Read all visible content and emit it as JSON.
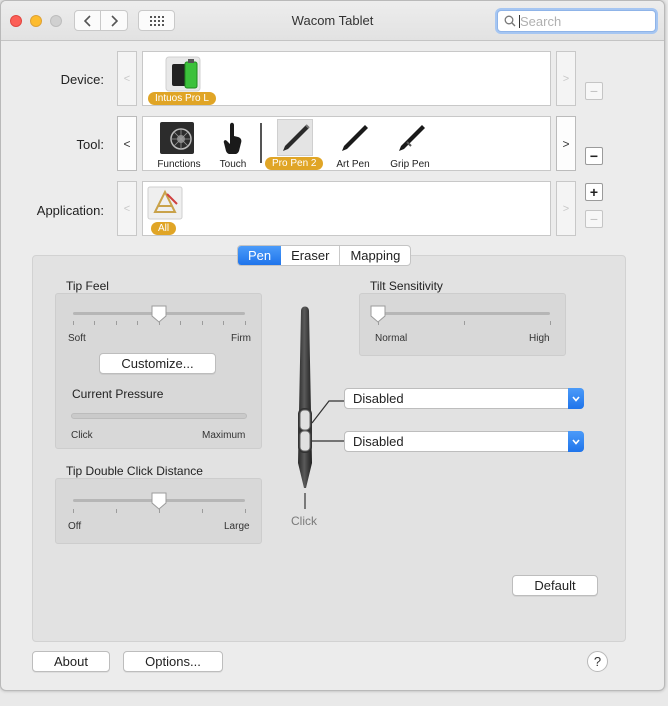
{
  "window": {
    "title": "Wacom Tablet",
    "search": {
      "placeholder": "Search"
    }
  },
  "device": {
    "label": "Device:",
    "items": [
      {
        "name": "Intuos Pro L",
        "selected": true
      }
    ]
  },
  "tool": {
    "label": "Tool:",
    "items": [
      {
        "name": "Functions"
      },
      {
        "name": "Touch"
      },
      {
        "name": "Pro Pen 2",
        "selected": true
      },
      {
        "name": "Art Pen"
      },
      {
        "name": "Grip Pen"
      }
    ]
  },
  "application": {
    "label": "Application:",
    "items": [
      {
        "name": "All",
        "selected": true
      }
    ]
  },
  "tabs": [
    "Pen",
    "Eraser",
    "Mapping"
  ],
  "tip_feel": {
    "title": "Tip Feel",
    "min_label": "Soft",
    "max_label": "Firm",
    "value": 0.5,
    "customize_label": "Customize...",
    "pressure_title": "Current Pressure",
    "pressure_min": "Click",
    "pressure_max": "Maximum",
    "pressure_value": 0
  },
  "tilt": {
    "title": "Tilt Sensitivity",
    "min_label": "Normal",
    "max_label": "High",
    "value": 0
  },
  "double_click": {
    "title": "Tip Double Click Distance",
    "min_label": "Off",
    "max_label": "Large",
    "value": 0.5
  },
  "pen_buttons": {
    "upper": "Disabled",
    "lower": "Disabled",
    "tip": "Click"
  },
  "buttons": {
    "default": "Default",
    "about": "About",
    "options": "Options..."
  },
  "help_label": "?",
  "colors": {
    "accent": "#1f74eb",
    "badge": "#e0a526"
  }
}
